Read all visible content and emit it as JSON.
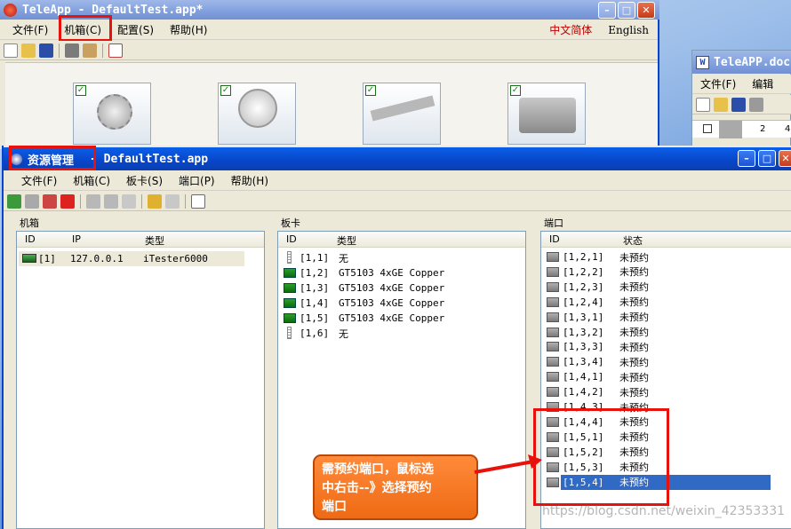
{
  "main_window": {
    "title": "TeleApp  - DefaultTest.app*",
    "menu": [
      "文件(F)",
      "机箱(C)",
      "配置(S)",
      "帮助(H)"
    ],
    "lang_cn": "中文简体",
    "lang_en": "English"
  },
  "doc_window": {
    "title": "TeleAPP.doc",
    "menu": [
      "文件(F)",
      "编辑"
    ],
    "ruler": [
      "2",
      "4"
    ]
  },
  "resource_window": {
    "title": "资源管理",
    "subtitle": "- DefaultTest.app",
    "menu": [
      "文件(F)",
      "机箱(C)",
      "板卡(S)",
      "端口(P)",
      "帮助(H)"
    ]
  },
  "chassis_pane": {
    "title": "机箱",
    "headers": [
      "ID",
      "IP",
      "类型"
    ],
    "rows": [
      {
        "id": "[1]",
        "ip": "127.0.0.1",
        "type": "iTester6000"
      }
    ]
  },
  "card_pane": {
    "title": "板卡",
    "headers": [
      "ID",
      "类型"
    ],
    "rows": [
      {
        "id": "[1,1]",
        "type": "无",
        "icon": "slot"
      },
      {
        "id": "[1,2]",
        "type": "GT5103 4xGE Copper",
        "icon": "card"
      },
      {
        "id": "[1,3]",
        "type": "GT5103 4xGE Copper",
        "icon": "card"
      },
      {
        "id": "[1,4]",
        "type": "GT5103 4xGE Copper",
        "icon": "card"
      },
      {
        "id": "[1,5]",
        "type": "GT5103 4xGE Copper",
        "icon": "card"
      },
      {
        "id": "[1,6]",
        "type": "无",
        "icon": "slot"
      }
    ]
  },
  "port_pane": {
    "title": "端口",
    "headers": [
      "ID",
      "状态"
    ],
    "rows": [
      {
        "id": "[1,2,1]",
        "status": "未预约"
      },
      {
        "id": "[1,2,2]",
        "status": "未预约"
      },
      {
        "id": "[1,2,3]",
        "status": "未预约"
      },
      {
        "id": "[1,2,4]",
        "status": "未预约"
      },
      {
        "id": "[1,3,1]",
        "status": "未预约"
      },
      {
        "id": "[1,3,2]",
        "status": "未预约"
      },
      {
        "id": "[1,3,3]",
        "status": "未预约"
      },
      {
        "id": "[1,3,4]",
        "status": "未预约"
      },
      {
        "id": "[1,4,1]",
        "status": "未预约"
      },
      {
        "id": "[1,4,2]",
        "status": "未预约"
      },
      {
        "id": "[1,4,3]",
        "status": "未预约"
      },
      {
        "id": "[1,4,4]",
        "status": "未预约"
      },
      {
        "id": "[1,5,1]",
        "status": "未预约"
      },
      {
        "id": "[1,5,2]",
        "status": "未预约"
      },
      {
        "id": "[1,5,3]",
        "status": "未预约"
      },
      {
        "id": "[1,5,4]",
        "status": "未预约"
      }
    ],
    "selected_index": 15
  },
  "callout": {
    "text_line1": "需预约端口，鼠标选",
    "text_line2": "中右击--》选择预约",
    "text_line3": "端口"
  },
  "watermark": "https://blog.csdn.net/weixin_42353331",
  "colors": {
    "highlight": "#e8120c",
    "selection": "#316ac5",
    "callout": "#ef6a14"
  }
}
